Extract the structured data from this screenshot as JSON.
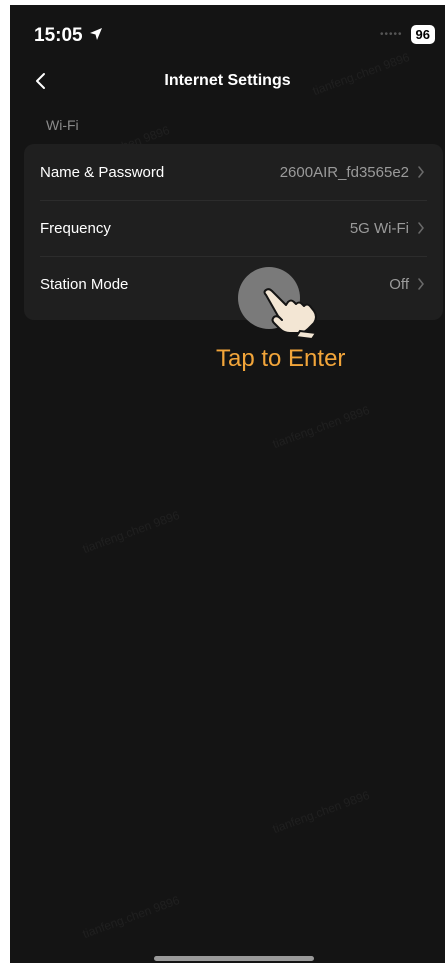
{
  "status_bar": {
    "time": "15:05",
    "battery": "96",
    "location_icon": "location-arrow-icon"
  },
  "nav": {
    "title": "Internet Settings",
    "back_icon": "chevron-left-icon"
  },
  "wifi_section": {
    "label": "Wi-Fi",
    "rows": [
      {
        "label": "Name & Password",
        "value": "2600AIR_fd3565e2"
      },
      {
        "label": "Frequency",
        "value": "5G Wi-Fi"
      },
      {
        "label": "Station Mode",
        "value": "Off"
      }
    ]
  },
  "tap_hint": {
    "text": "Tap to Enter",
    "icon": "pointing-hand-icon",
    "color": "#f2a53a"
  },
  "watermark": {
    "text": "tianfeng.chen 9896"
  },
  "colors": {
    "background": "#141414",
    "card": "#1f1f1f",
    "text_secondary": "#9a9a9a"
  }
}
